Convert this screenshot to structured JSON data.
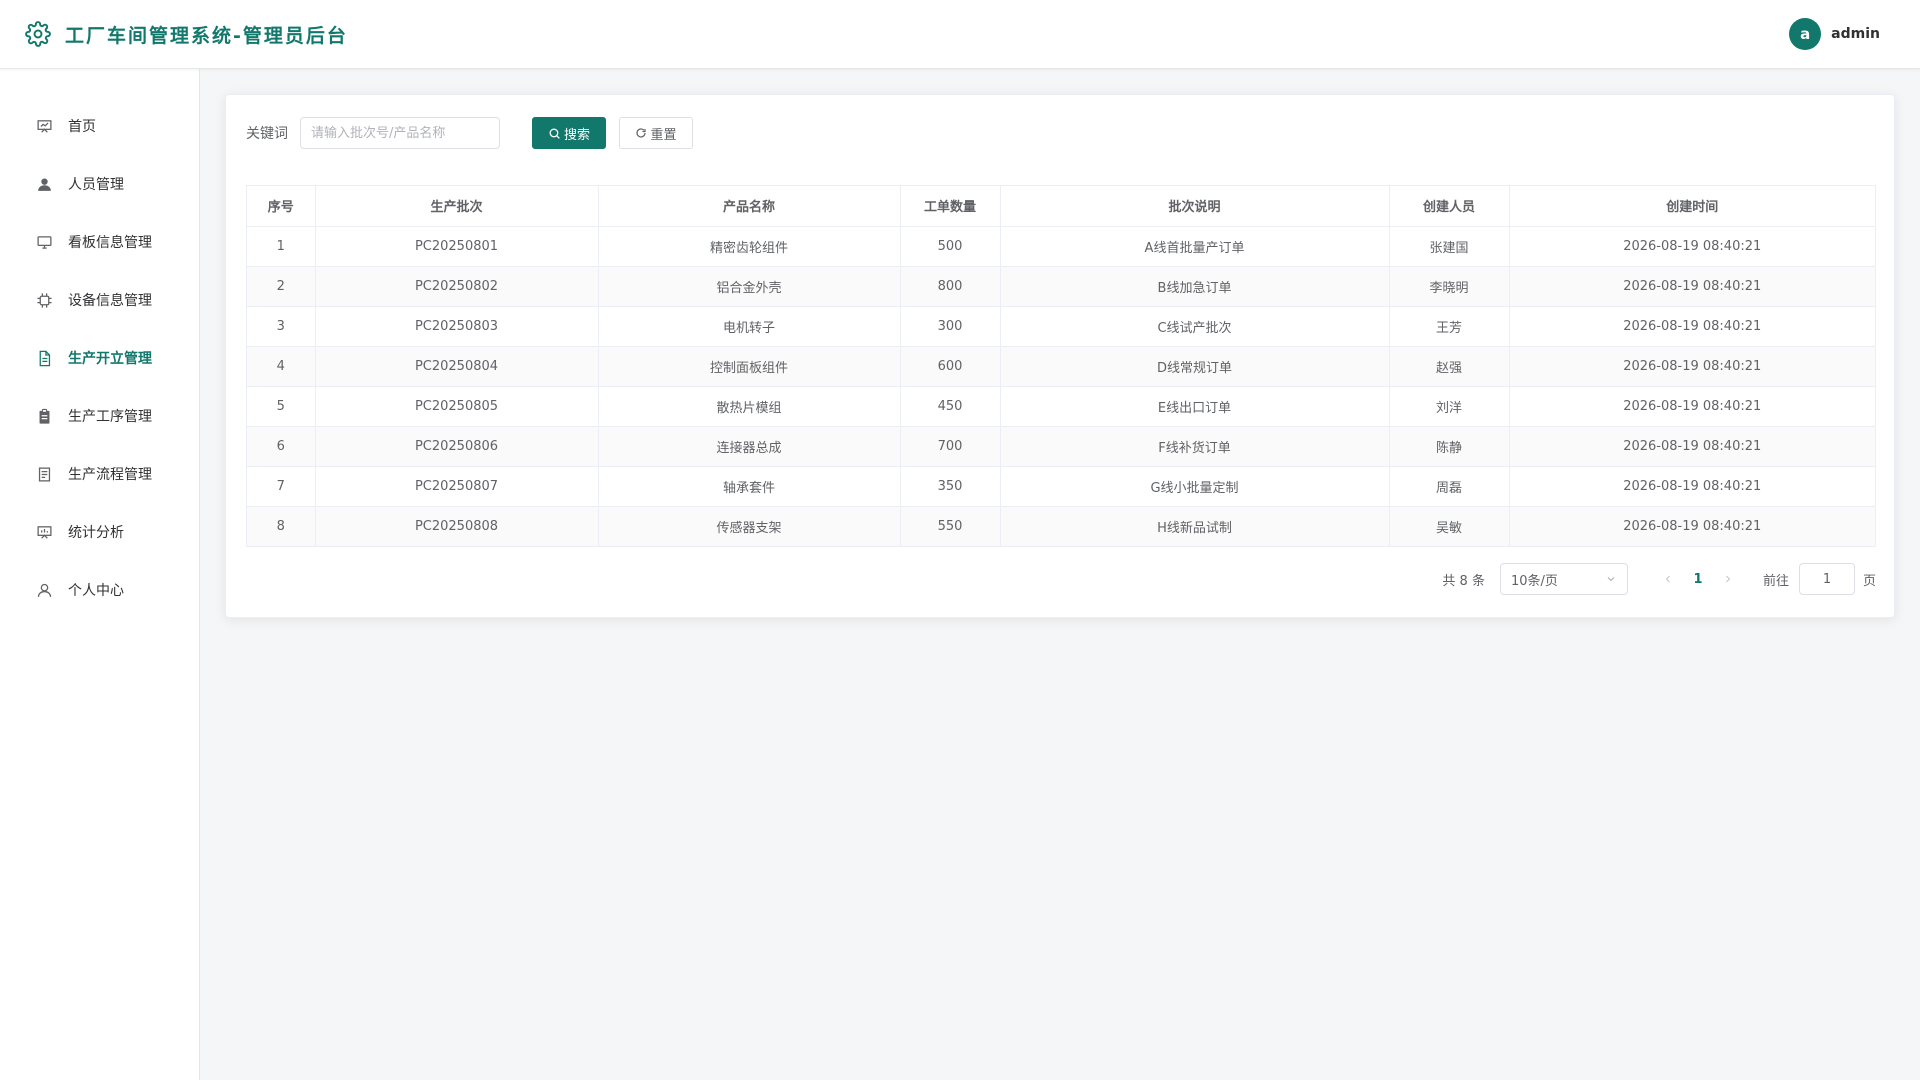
{
  "header": {
    "title": "工厂车间管理系统-管理员后台",
    "logo_icon": "gear-icon",
    "avatar_letter": "a",
    "username": "admin",
    "accent_color": "#11786b"
  },
  "sidebar": {
    "items": [
      {
        "label": "首页",
        "icon": "presentation-icon",
        "active": false
      },
      {
        "label": "人员管理",
        "icon": "user-filled-icon",
        "active": false
      },
      {
        "label": "看板信息管理",
        "icon": "monitor-icon",
        "active": false
      },
      {
        "label": "设备信息管理",
        "icon": "cpu-icon",
        "active": false
      },
      {
        "label": "生产开立管理",
        "icon": "document-icon",
        "active": true
      },
      {
        "label": "生产工序管理",
        "icon": "clipboard-icon",
        "active": false
      },
      {
        "label": "生产流程管理",
        "icon": "tickets-icon",
        "active": false
      },
      {
        "label": "统计分析",
        "icon": "data-board-icon",
        "active": false
      },
      {
        "label": "个人中心",
        "icon": "user-icon",
        "active": false
      }
    ]
  },
  "search": {
    "label": "关键词",
    "placeholder": "请输入批次号/产品名称",
    "value": "",
    "search_button": "搜索",
    "reset_button": "重置"
  },
  "table": {
    "columns": [
      "序号",
      "生产批次",
      "产品名称",
      "工单数量",
      "批次说明",
      "创建人员",
      "创建时间"
    ],
    "rows": [
      [
        "1",
        "PC20250801",
        "精密齿轮组件",
        "500",
        "A线首批量产订单",
        "张建国",
        "2026-08-19 08:40:21"
      ],
      [
        "2",
        "PC20250802",
        "铝合金外壳",
        "800",
        "B线加急订单",
        "李晓明",
        "2026-08-19 08:40:21"
      ],
      [
        "3",
        "PC20250803",
        "电机转子",
        "300",
        "C线试产批次",
        "王芳",
        "2026-08-19 08:40:21"
      ],
      [
        "4",
        "PC20250804",
        "控制面板组件",
        "600",
        "D线常规订单",
        "赵强",
        "2026-08-19 08:40:21"
      ],
      [
        "5",
        "PC20250805",
        "散热片模组",
        "450",
        "E线出口订单",
        "刘洋",
        "2026-08-19 08:40:21"
      ],
      [
        "6",
        "PC20250806",
        "连接器总成",
        "700",
        "F线补货订单",
        "陈静",
        "2026-08-19 08:40:21"
      ],
      [
        "7",
        "PC20250807",
        "轴承套件",
        "350",
        "G线小批量定制",
        "周磊",
        "2026-08-19 08:40:21"
      ],
      [
        "8",
        "PC20250808",
        "传感器支架",
        "550",
        "H线新品试制",
        "吴敏",
        "2026-08-19 08:40:21"
      ]
    ]
  },
  "pagination": {
    "total_text": "共 8 条",
    "page_size": "10条/页",
    "current_page": "1",
    "goto_label": "前往",
    "goto_value": "1",
    "page_suffix": "页"
  }
}
